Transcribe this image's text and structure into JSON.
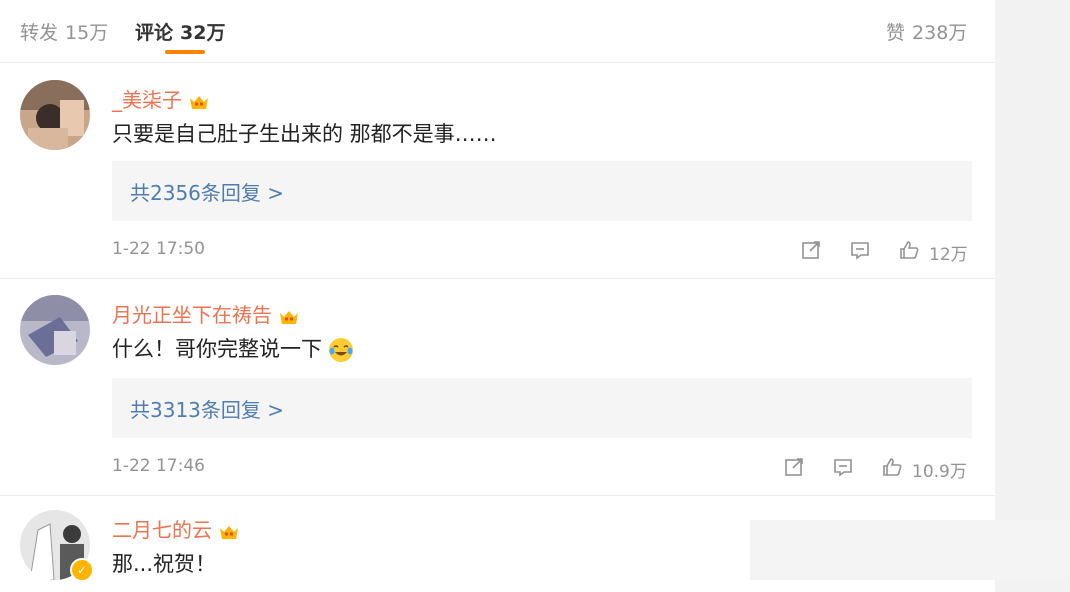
{
  "tabs": {
    "repost": {
      "label": "转发",
      "count": "15万"
    },
    "comment": {
      "label": "评论",
      "count": "32万"
    },
    "like": {
      "label": "赞",
      "count": "238万"
    }
  },
  "comments": [
    {
      "username": "_美柒子",
      "text": "只要是自己肚子生出来的 那都不是事……",
      "replies": "共2356条回复 >",
      "time": "1-22 17:50",
      "likes": "12万"
    },
    {
      "username": "月光正坐下在祷告",
      "text": "什么！哥你完整说一下",
      "replies": "共3313条回复 >",
      "time": "1-22 17:46",
      "likes": "10.9万"
    },
    {
      "username": "二月七的云",
      "text": "那...祝贺！"
    }
  ],
  "colors": {
    "accent": "#ff8200",
    "username": "#eb7350",
    "link": "#507daf",
    "muted": "#939393"
  }
}
